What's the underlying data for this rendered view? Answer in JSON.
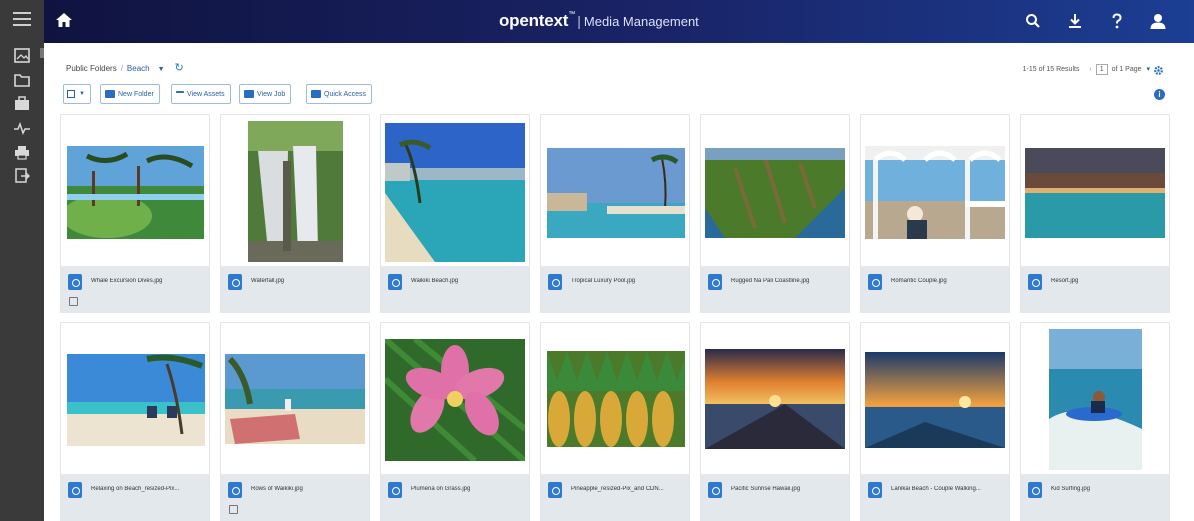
{
  "app": {
    "brand": "opentext",
    "trademark": "™",
    "separator": "|",
    "product": "Media Management"
  },
  "topbar_icons": [
    "home-icon",
    "search-icon",
    "download-icon",
    "help-icon",
    "user-icon"
  ],
  "rail_icons": [
    "menu-icon",
    "gallery-icon",
    "folder-icon",
    "briefcase-icon",
    "activity-icon",
    "printer-icon",
    "export-icon"
  ],
  "breadcrumb": {
    "root": "Public Folders",
    "separator": "/",
    "current": "Beach"
  },
  "toolbar": {
    "new_folder": "New Folder",
    "view_assets": "View Assets",
    "view_job": "View Job",
    "quick_access": "Quick Access"
  },
  "paging": {
    "results": "1-15 of 15 Results",
    "page": "1",
    "of_pages": "of 1 Page"
  },
  "assets": [
    {
      "name": "Whale Excursion Dives.jpg",
      "has_sub": true
    },
    {
      "name": "Waterfall.jpg",
      "has_sub": false
    },
    {
      "name": "Waikiki Beach.jpg",
      "has_sub": false
    },
    {
      "name": "Tropical Luxury Pool.jpg",
      "has_sub": false
    },
    {
      "name": "Rugged Na Pali Coastline.jpg",
      "has_sub": false
    },
    {
      "name": "Romantic Couple.jpg",
      "has_sub": false
    },
    {
      "name": "Resort.jpg",
      "has_sub": false
    },
    {
      "name": "Relaxing on Beach_resized-Pix...",
      "has_sub": false
    },
    {
      "name": "Rows of Waikiki.jpg",
      "has_sub": true
    },
    {
      "name": "Plumeria on Grass.jpg",
      "has_sub": false
    },
    {
      "name": "Pineapple_resized-Pix_and CDN...",
      "has_sub": false
    },
    {
      "name": "Pacific Sunrise Hawaii.jpg",
      "has_sub": false
    },
    {
      "name": "Lanikai Beach - Couple Walking...",
      "has_sub": false
    },
    {
      "name": "Kid Surfing.jpg",
      "has_sub": false
    }
  ]
}
